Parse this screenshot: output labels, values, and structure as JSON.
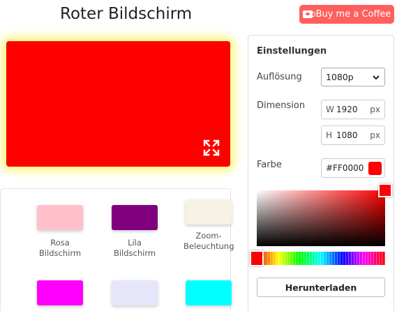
{
  "header": {
    "title": "Roter Bildschirm",
    "coffee_label": "Buy me a Coffee",
    "coffee_icon": "coffee-cup-icon"
  },
  "preview": {
    "color": "#FF0000",
    "glow_color": "#FBF56B",
    "fullscreen_icon": "fullscreen-expand-icon"
  },
  "swatches": [
    {
      "label": "Rosa Bildschirm",
      "color": "#FFC0CB"
    },
    {
      "label": "Lila Bildschirm",
      "color": "#800080"
    },
    {
      "label": "Zoom-Beleuchtung",
      "color": "#F8F2E4"
    },
    {
      "label": "",
      "color": "#FF00FF"
    },
    {
      "label": "",
      "color": "#E6E6FA"
    },
    {
      "label": "",
      "color": "#00FFFF"
    }
  ],
  "settings": {
    "title": "Einstellungen",
    "resolution_label": "Auflösung",
    "resolution_value": "1080p",
    "dimension_label": "Dimension",
    "width_prefix": "W",
    "width_value": "1920",
    "height_prefix": "H",
    "height_value": "1080",
    "unit": "px",
    "color_label": "Farbe",
    "color_hex": "#FF0000",
    "download_label": "Herunterladen"
  },
  "colors": {
    "accent": "#FF5F5F",
    "primary": "#FF0000"
  }
}
